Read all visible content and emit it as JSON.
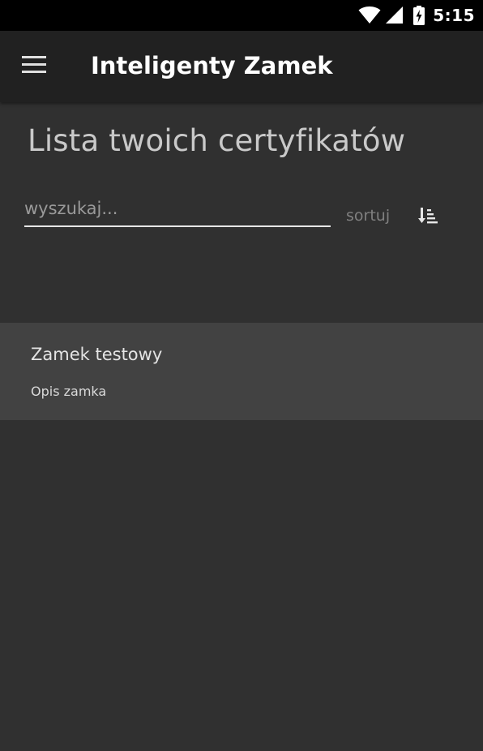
{
  "status_bar": {
    "time": "5:15",
    "icons": [
      "wifi-icon",
      "cell-signal-icon",
      "battery-charging-icon"
    ]
  },
  "app_bar": {
    "menu_icon": "hamburger-menu-icon",
    "title": "Inteligenty Zamek"
  },
  "header": {
    "title": "Lista twoich certyfikatów"
  },
  "search": {
    "value": "",
    "placeholder": "wyszukaj..."
  },
  "sort": {
    "label": "sortuj",
    "icon": "sort-descending-icon"
  },
  "certificates": [
    {
      "name": "Zamek testowy",
      "description": "Opis zamka"
    }
  ],
  "colors": {
    "status_bar": "#000000",
    "app_bar": "#212121",
    "background": "#303030",
    "card": "#424242",
    "search_underline": "#e6e6e6"
  }
}
